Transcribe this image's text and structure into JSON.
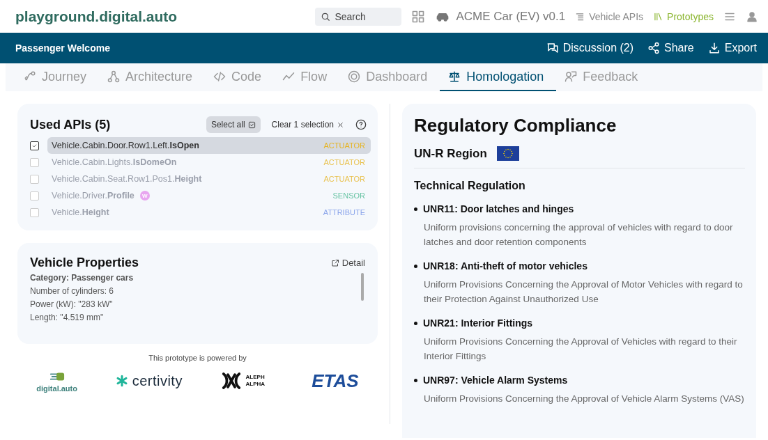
{
  "header": {
    "logo": "playground.digital.auto",
    "search": {
      "placeholder": "Search"
    },
    "model": "ACME Car (EV) v0.1",
    "nav": [
      {
        "label": "Vehicle APIs",
        "selected": false
      },
      {
        "label": "Prototypes",
        "selected": true
      }
    ]
  },
  "prototype_bar": {
    "title": "Passenger Welcome",
    "actions": [
      {
        "kind": "discussion",
        "label": "Discussion (2)"
      },
      {
        "kind": "share",
        "label": "Share"
      },
      {
        "kind": "export",
        "label": "Export"
      }
    ]
  },
  "tabs": [
    {
      "kind": "journey",
      "label": "Journey",
      "selected": false
    },
    {
      "kind": "architecture",
      "label": "Architecture",
      "selected": false
    },
    {
      "kind": "code",
      "label": "Code",
      "selected": false
    },
    {
      "kind": "flow",
      "label": "Flow",
      "selected": false
    },
    {
      "kind": "dashboard",
      "label": "Dashboard",
      "selected": false
    },
    {
      "kind": "homologation",
      "label": "Homologation",
      "selected": true
    },
    {
      "kind": "feedback",
      "label": "Feedback",
      "selected": false
    }
  ],
  "used_apis": {
    "title": "Used APIs (5)",
    "select_all": "Select all",
    "clear": "Clear 1 selection",
    "apis": [
      {
        "path": "Vehicle.Cabin.Door.Row1.Left.**IsOpen**",
        "type": "ACTUATOR",
        "checked": true,
        "wishlist": false
      },
      {
        "path": "Vehicle.Cabin.Lights.**IsDomeOn**",
        "type": "ACTUATOR",
        "checked": false,
        "wishlist": false
      },
      {
        "path": "Vehicle.Cabin.Seat.Row1.Pos1.**Height**",
        "type": "ACTUATOR",
        "checked": false,
        "wishlist": false
      },
      {
        "path": "Vehicle.Driver.**Profile**",
        "type": "SENSOR",
        "checked": false,
        "wishlist": true,
        "badge": "W"
      },
      {
        "path": "Vehicle.**Height**",
        "type": "ATTRIBUTE",
        "checked": false,
        "wishlist": false
      }
    ]
  },
  "vehicle_properties": {
    "title": "Vehicle Properties",
    "detail": "Detail",
    "category": "Category: Passenger cars",
    "lines": [
      "Number of cylinders: 6",
      "Power (kW): \"283 kW\"",
      "Length: \"4.519 mm\""
    ]
  },
  "powered_by": {
    "caption": "This prototype is powered by",
    "partners": [
      {
        "kind": "digital",
        "name": "digital.auto"
      },
      {
        "kind": "certivity",
        "name": "certivity"
      },
      {
        "kind": "aleph",
        "name": "ALEPH ALPHA"
      },
      {
        "kind": "etas",
        "name": "ETAS"
      }
    ]
  },
  "compliance": {
    "title": "Regulatory Compliance",
    "region": "UN-R Region",
    "section": "Technical Regulation",
    "regulations": [
      {
        "title": "UNR11: Door latches and hinges",
        "description": "Uniform provisions concerning the approval of vehicles with regard to door latches and door retention components"
      },
      {
        "title": "UNR18: Anti-theft of motor vehicles",
        "description": "Uniform Provisions Concerning the Approval of Motor Vehicles with regard to their Protection Against Unauthorized Use"
      },
      {
        "title": "UNR21: Interior Fittings",
        "description": "Uniform Provisions Concerning the Approval of Vehicles with regard to their Interior Fittings"
      },
      {
        "title": "UNR97: Vehicle Alarm Systems",
        "description": "Uniform Provisions Concerning the Approval of Vehicle Alarm Systems (VAS)"
      }
    ]
  }
}
